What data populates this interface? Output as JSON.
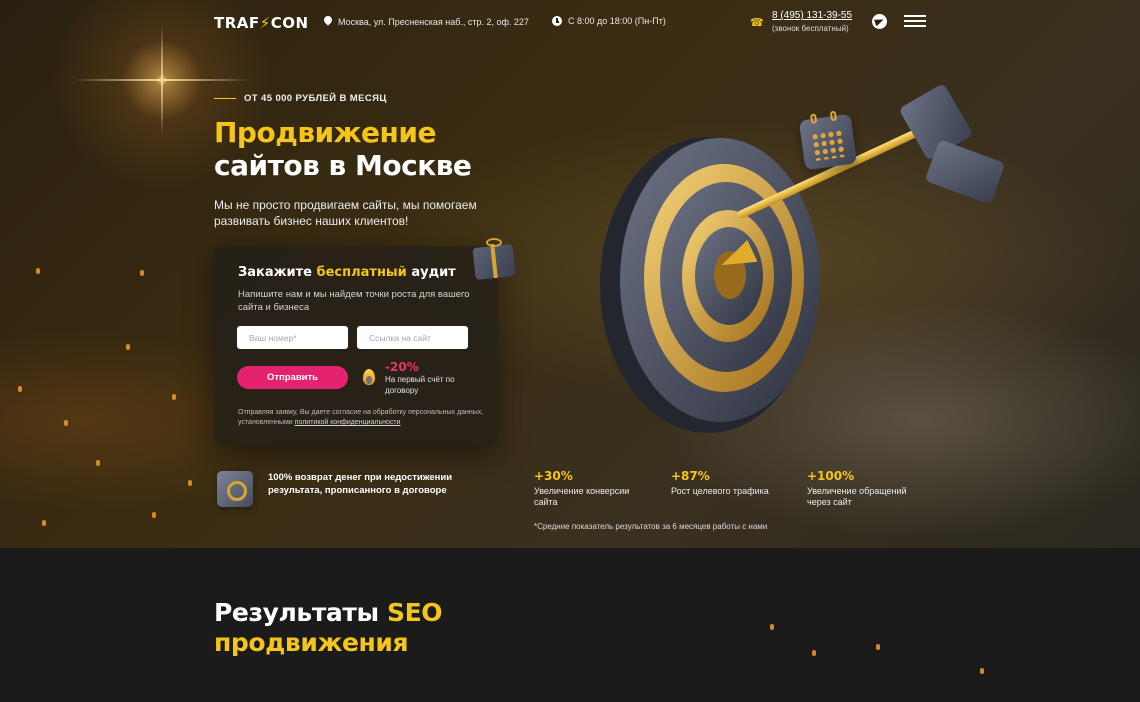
{
  "header": {
    "logo_left": "TRAF",
    "logo_mid": "⚡",
    "logo_right": "CON",
    "address": "Москва, ул. Пресненская наб., стр. 2, оф. 227",
    "hours": "С 8:00 до 18:00 (Пн-Пт)",
    "phone": "8 (495) 131-39-55",
    "phone_note": "(звонок бесплатный)"
  },
  "hero": {
    "eyebrow": "ОТ 45 000 РУБЛЕЙ В МЕСЯЦ",
    "title_line1": "Продвижение",
    "title_line2": "сайтов в Москве",
    "subtitle": "Мы не просто продвигаем сайты, мы помогаем развивать бизнес наших клиентов!"
  },
  "form": {
    "title_prefix": "Закажите ",
    "title_highlight": "бесплатный",
    "title_suffix": " аудит",
    "description": "Напишите нам и мы найдем точки роста для вашего сайта и бизнеса",
    "phone_placeholder": "Ваш номер*",
    "site_placeholder": "Ссылка на сайт",
    "submit_label": "Отправить",
    "discount": "-20%",
    "discount_note": "На первый счёт по договору",
    "consent_text": "Отправляя заявку, Вы даете согласие на обработку персональных данных, установленными ",
    "consent_link": "политикой конфиденциальности"
  },
  "guarantee": {
    "text": "100% возврат денег при недостижении результата, прописанного в договоре"
  },
  "stats": {
    "items": [
      {
        "value": "+30%",
        "label": "Увеличение конверсии сайта"
      },
      {
        "value": "+87%",
        "label": "Рост целевого трафика"
      },
      {
        "value": "+100%",
        "label": "Увеличение обращений через сайт"
      }
    ],
    "note": "*Средние показатель результатов за 6 месяцев работы с нами"
  },
  "results": {
    "title_white": "Результаты ",
    "title_yellow": "SEO",
    "title_line2": "продвижения"
  },
  "colors": {
    "accent": "#f5c518",
    "cta": "#e5226e",
    "discount": "#ee3568",
    "dark": "#1b1b1b"
  }
}
